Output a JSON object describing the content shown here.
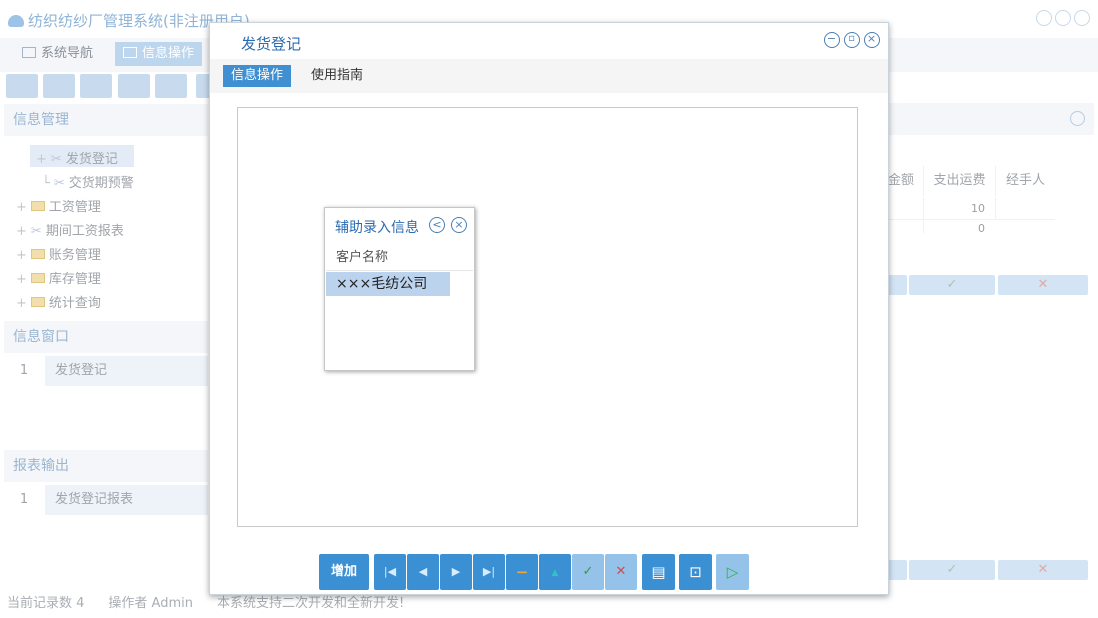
{
  "background": {
    "app_title": "纺织纺纱厂管理系统(非注册用户)",
    "tabs": [
      "系统导航",
      "信息操作"
    ],
    "panels": {
      "info_manage": "信息管理",
      "info_window": "信息窗口",
      "report_output": "报表输出"
    },
    "tree": [
      "发货登记",
      "交货期预警",
      "工资管理",
      "期间工资报表",
      "账务管理",
      "库存管理",
      "统计查询"
    ],
    "window_rows": [
      {
        "num": "1",
        "label": "发货登记"
      }
    ],
    "report_rows": [
      {
        "num": "1",
        "label": "发货登记报表"
      }
    ],
    "grid_headers": [
      "金额",
      "支出运费",
      "经手人"
    ],
    "grid_values": [
      "10",
      "0"
    ],
    "status": [
      "当前记录数 4",
      "操作者 Admin",
      "本系统支持二次开发和全新开发!"
    ]
  },
  "modal": {
    "title": "发货登记",
    "menus": [
      "信息操作",
      "使用指南"
    ]
  },
  "assist": {
    "title": "辅助录入信息",
    "column": "客户名称",
    "rows": [
      "×××毛纺公司"
    ]
  },
  "toolbar": {
    "add": "增加"
  }
}
